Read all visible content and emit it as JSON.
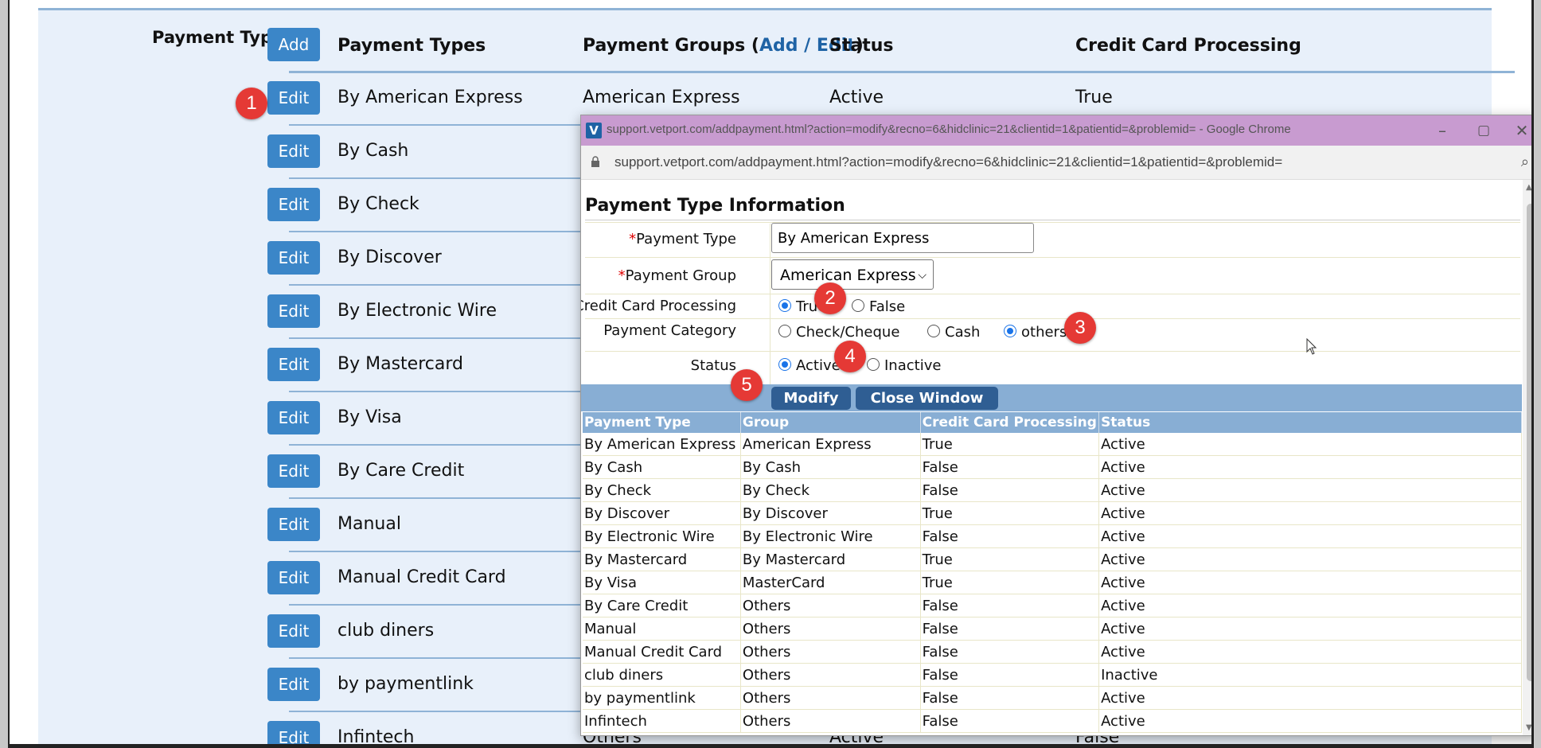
{
  "background": {
    "section_label": "Payment Types",
    "add_label": "Add",
    "headers": {
      "payment_types": "Payment Types",
      "payment_groups_prefix": "Payment Groups (",
      "add_edit": "Add / Edit",
      "payment_groups_suffix": ")",
      "status": "Status",
      "ccp": "Credit Card Processing"
    },
    "edit_label": "Edit",
    "rows": [
      {
        "type": "By American Express",
        "group": "American Express",
        "status": "Active",
        "ccp": "True"
      },
      {
        "type": "By Cash"
      },
      {
        "type": "By Check"
      },
      {
        "type": "By Discover"
      },
      {
        "type": "By Electronic Wire"
      },
      {
        "type": "By Mastercard"
      },
      {
        "type": "By Visa"
      },
      {
        "type": "By Care Credit"
      },
      {
        "type": "Manual"
      },
      {
        "type": "Manual Credit Card"
      },
      {
        "type": "club diners"
      },
      {
        "type": "by paymentlink"
      },
      {
        "type": "Infintech",
        "group": "Others",
        "status": "Active",
        "ccp": "False"
      }
    ]
  },
  "badges": [
    "1",
    "2",
    "3",
    "4",
    "5"
  ],
  "popup": {
    "window_title": "support.vetport.com/addpayment.html?action=modify&recno=6&hidclinic=21&clientid=1&patientid=&problemid= - Google Chrome",
    "url": "support.vetport.com/addpayment.html?action=modify&recno=6&hidclinic=21&clientid=1&patientid=&problemid=",
    "form_title": "Payment Type Information",
    "required_mark": "*",
    "labels": {
      "payment_type": "Payment Type",
      "payment_group": "Payment Group",
      "ccp": "Credit Card Processing",
      "category": "Payment Category",
      "status": "Status"
    },
    "payment_type_value": "By American Express",
    "payment_group_value": "American Express",
    "ccp_options": {
      "true": "True",
      "false": "False",
      "selected": "True"
    },
    "category_options": {
      "check": "Check/Cheque",
      "cash": "Cash",
      "others": "others",
      "selected": "others"
    },
    "status_options": {
      "active": "Active",
      "inactive": "Inactive",
      "selected": "Active"
    },
    "buttons": {
      "modify": "Modify",
      "close": "Close Window"
    },
    "table": {
      "headers": [
        "Payment Type",
        "Group",
        "Credit Card Processing",
        "Status"
      ],
      "rows": [
        [
          "By American Express",
          "American Express",
          "True",
          "Active"
        ],
        [
          "By Cash",
          "By Cash",
          "False",
          "Active"
        ],
        [
          "By Check",
          "By Check",
          "False",
          "Active"
        ],
        [
          "By Discover",
          "By Discover",
          "True",
          "Active"
        ],
        [
          "By Electronic Wire",
          "By Electronic Wire",
          "False",
          "Active"
        ],
        [
          "By Mastercard",
          "By Mastercard",
          "True",
          "Active"
        ],
        [
          "By Visa",
          "MasterCard",
          "True",
          "Active"
        ],
        [
          "By Care Credit",
          "Others",
          "False",
          "Active"
        ],
        [
          "Manual",
          "Others",
          "False",
          "Active"
        ],
        [
          "Manual Credit Card",
          "Others",
          "False",
          "Active"
        ],
        [
          "club diners",
          "Others",
          "False",
          "Inactive"
        ],
        [
          "by paymentlink",
          "Others",
          "False",
          "Active"
        ],
        [
          "Infintech",
          "Others",
          "False",
          "Active"
        ]
      ]
    }
  },
  "colors": {
    "accent": "#3b86c8",
    "header_bar": "#88aed4",
    "badge": "#e53935",
    "titlebar": "#c89bd0"
  }
}
